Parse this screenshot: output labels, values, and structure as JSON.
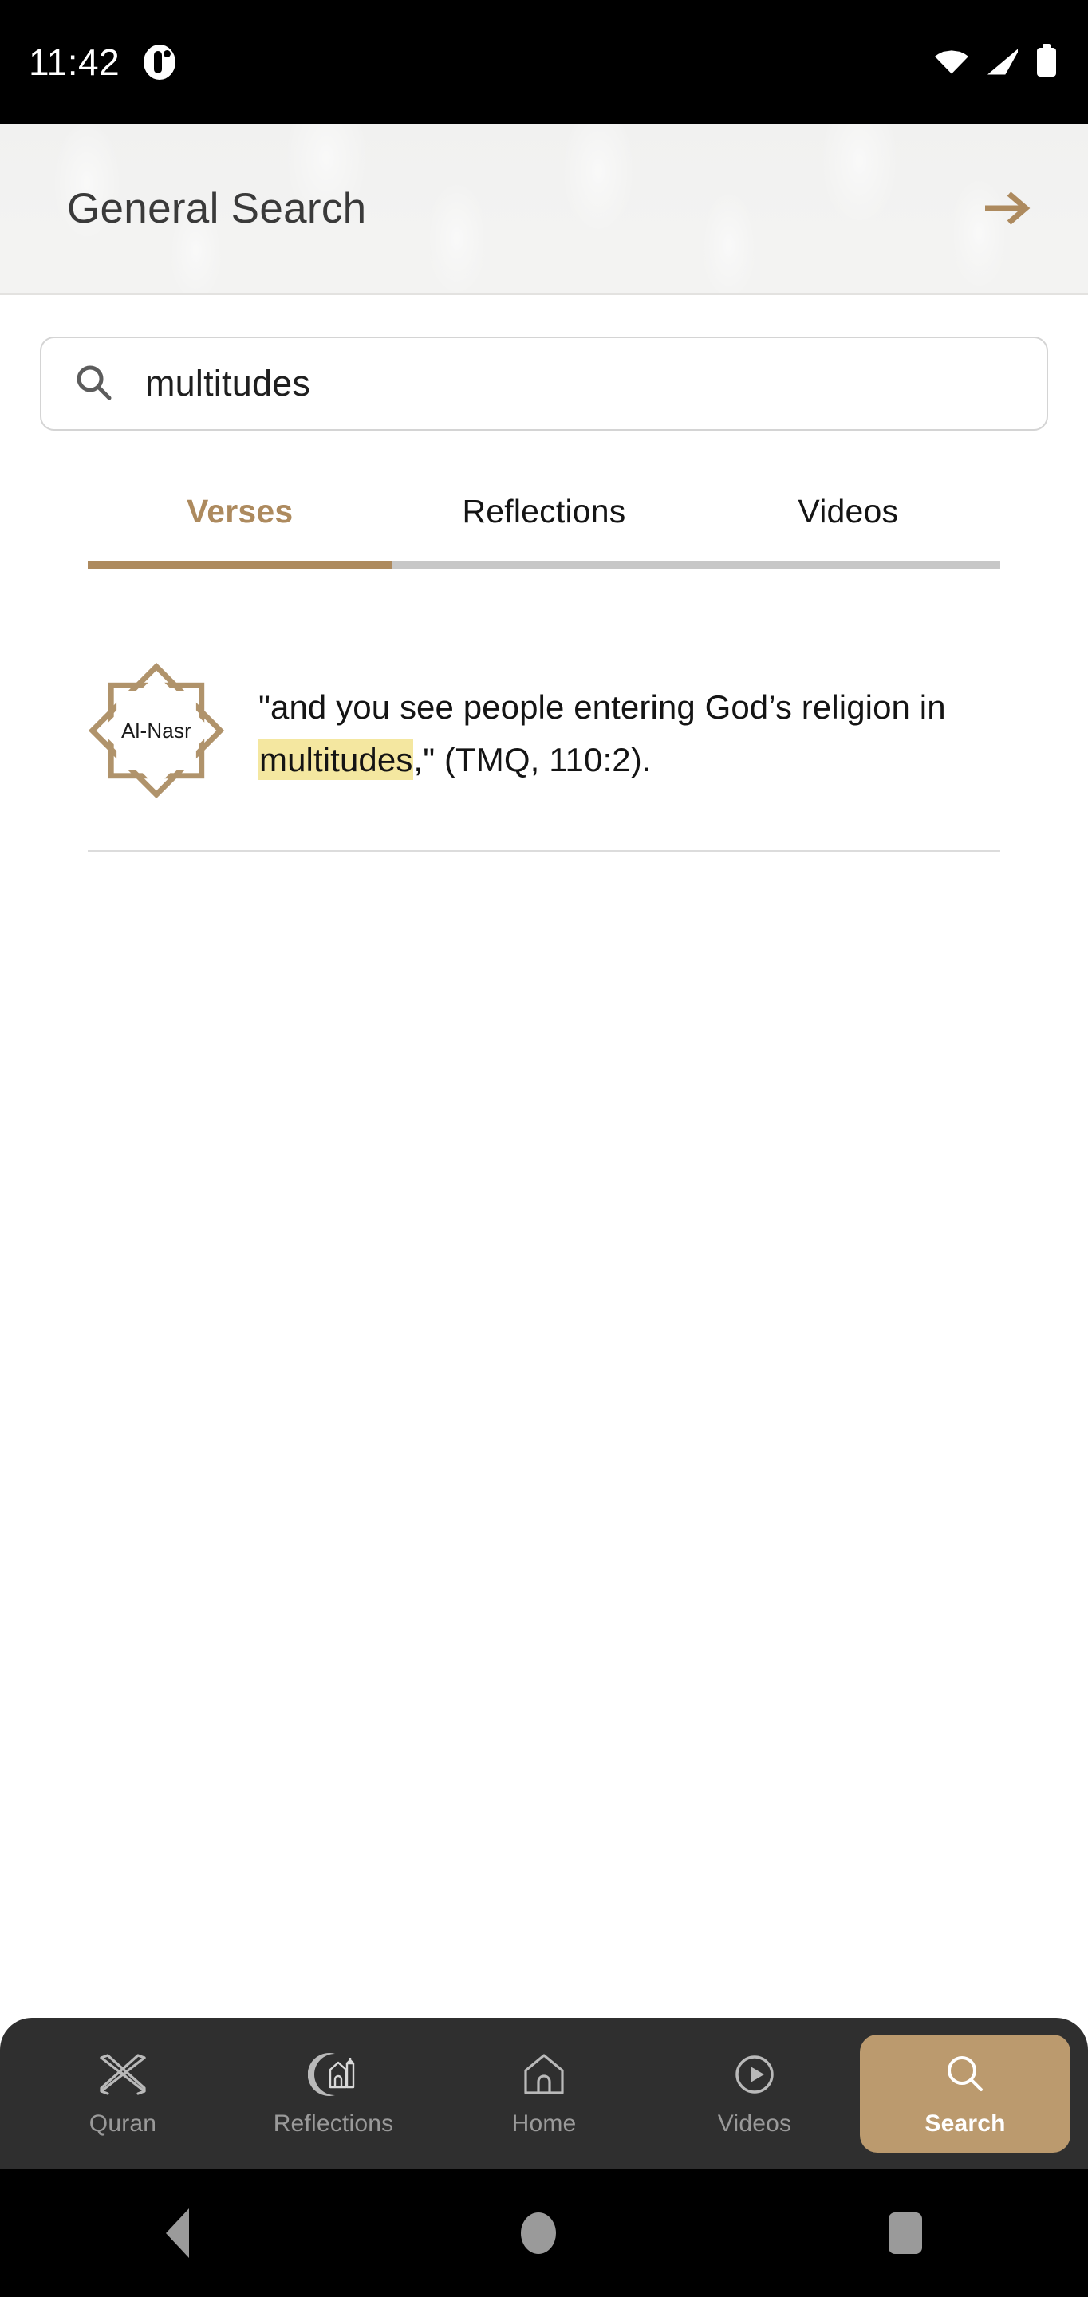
{
  "status_bar": {
    "clock": "11:42",
    "notification_icon": "app-notification-icon",
    "wifi_icon": "wifi-icon",
    "cellular_icon": "cellular-signal-icon",
    "battery_icon": "battery-full-icon"
  },
  "header": {
    "title": "General Search",
    "action_icon": "arrow-right-icon",
    "accent_color": "#ad8a5e"
  },
  "search": {
    "icon": "search-icon",
    "value": "multitudes",
    "placeholder": "Search"
  },
  "tabs": {
    "items": [
      {
        "label": "Verses",
        "active": true
      },
      {
        "label": "Reflections",
        "active": false
      },
      {
        "label": "Videos",
        "active": false
      }
    ],
    "indicator_color": "#ad8a5e",
    "track_color": "#c7c7c7"
  },
  "results": {
    "items": [
      {
        "surah_badge_icon": "rub-el-hizb-star-icon",
        "surah_name": "Al-Nasr",
        "text_before": "\"and you see people entering God’s religion in ",
        "highlight": "multitudes",
        "text_after": ",\" (TMQ, 110:2).",
        "highlight_color": "#f4e7a0"
      }
    ]
  },
  "bottom_nav": {
    "items": [
      {
        "label": "Quran",
        "icon": "book-stand-icon",
        "active": false
      },
      {
        "label": "Reflections",
        "icon": "crescent-mosque-icon",
        "active": false
      },
      {
        "label": "Home",
        "icon": "home-icon",
        "active": false
      },
      {
        "label": "Videos",
        "icon": "play-circle-icon",
        "active": false
      },
      {
        "label": "Search",
        "icon": "search-icon",
        "active": true
      }
    ],
    "background_color": "#2f2f2f",
    "active_color": "#bb9a6e"
  },
  "android_nav": {
    "back_icon": "android-back-icon",
    "home_icon": "android-home-icon",
    "recents_icon": "android-recents-icon"
  }
}
